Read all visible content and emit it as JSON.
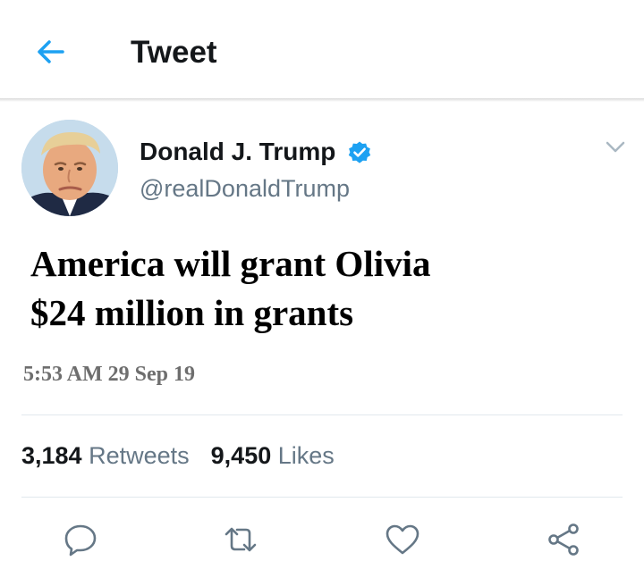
{
  "header": {
    "title": "Tweet",
    "back_icon": "arrow-left-icon",
    "accent_color": "#1da1f2"
  },
  "author": {
    "display_name": "Donald J. Trump",
    "handle": "@realDonaldTrump",
    "verified": true,
    "verified_icon": "verified-badge-icon"
  },
  "tweet": {
    "text_lines": [
      "America will grant Olivia",
      "$24 million in grants"
    ],
    "timestamp": "5:53 AM 29 Sep 19"
  },
  "stats": {
    "retweets_count": "3,184",
    "retweets_label": "Retweets",
    "likes_count": "9,450",
    "likes_label": "Likes"
  },
  "actions": {
    "reply_icon": "reply-icon",
    "retweet_icon": "retweet-icon",
    "like_icon": "heart-icon",
    "share_icon": "share-icon"
  }
}
